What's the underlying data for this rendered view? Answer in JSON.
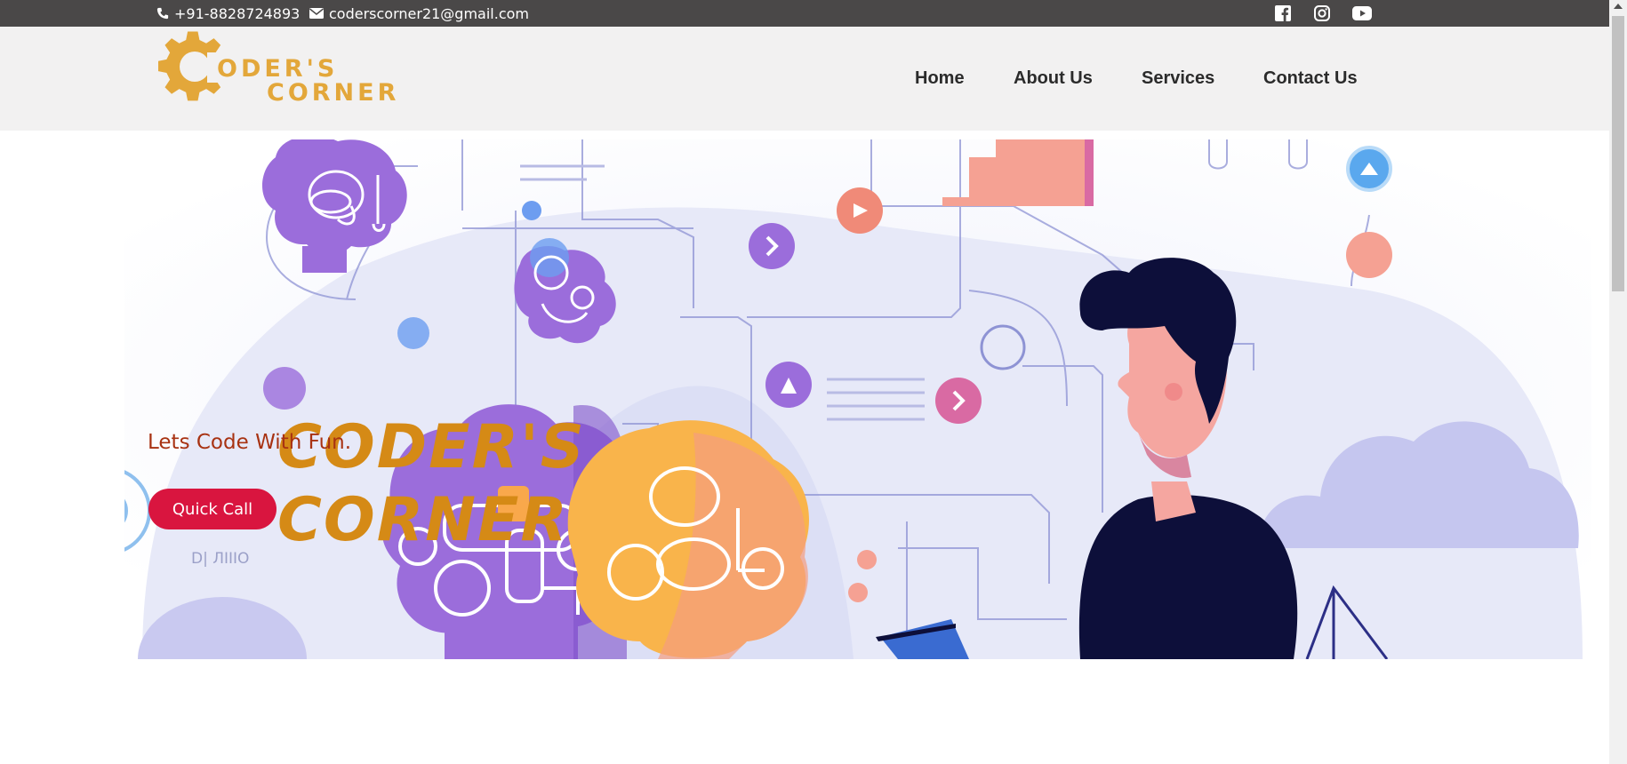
{
  "topbar": {
    "phone": "+91-8828724893",
    "email": "coderscorner21@gmail.com",
    "social": [
      "facebook-icon",
      "instagram-icon",
      "youtube-icon"
    ]
  },
  "logo": {
    "line1": "ODER'S",
    "line2": "CORNER"
  },
  "nav": {
    "items": [
      "Home",
      "About Us",
      "Services",
      "Contact Us"
    ]
  },
  "hero": {
    "title_line1": "CODER'S",
    "title_line2": "CORNER",
    "tagline": "Lets Code With Fun.",
    "button": "Quick Call"
  },
  "colors": {
    "topbar_bg": "#4a4848",
    "nav_bg": "#f2f1f1",
    "brand_gold": "#d58a16",
    "tagline": "#a83212",
    "button": "#d9153f",
    "illustration_purple": "#9b6ddb",
    "illustration_orange": "#f9b44b",
    "illustration_navy": "#0d0f3a"
  }
}
